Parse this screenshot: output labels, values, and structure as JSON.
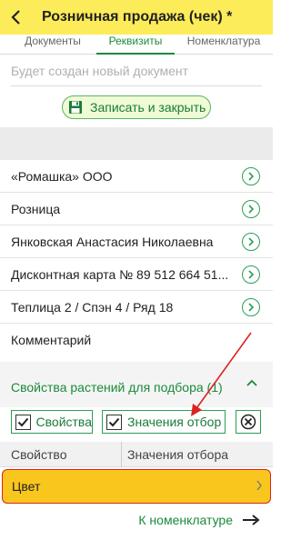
{
  "header": {
    "title": "Розничная продажа (чек) *",
    "back_icon": "chevron-left-icon"
  },
  "tabs": [
    {
      "label": "Документы",
      "active": false
    },
    {
      "label": "Реквизиты",
      "active": true
    },
    {
      "label": "Номенклатура",
      "active": false
    }
  ],
  "document": {
    "status_placeholder": "Будет создан новый документ",
    "save_button_label": "Записать и закрыть",
    "save_icon": "floppy-disk-icon"
  },
  "fields": [
    {
      "label": "«Ромашка» ООО"
    },
    {
      "label": "Розница"
    },
    {
      "label": "Янковская Анастасия Николаевна"
    },
    {
      "label": "Дисконтная карта № 89 512 664 51..."
    },
    {
      "label": "Теплица 2 / Спэн 4 / Ряд 18"
    }
  ],
  "comment": {
    "label": "Комментарий"
  },
  "properties": {
    "header": "Свойства растений для подбора (1)",
    "buttons": [
      {
        "label": "Свойства",
        "checked": true
      },
      {
        "label": "Значения отбор",
        "checked": true
      }
    ],
    "close_icon": "close-circle-icon",
    "table": {
      "columns": [
        "Свойство",
        "Значения отбора"
      ],
      "rows": [
        {
          "property": "Цвет",
          "value": ""
        }
      ]
    }
  },
  "footer": {
    "link_label": "К номенклатуре",
    "arrow_icon": "arrow-right-icon"
  },
  "colors": {
    "header_bg": "#fdec59",
    "accent_green": "#1a8a3a",
    "selected_row_bg": "#f8c61d",
    "annotation_red": "#dd2222"
  }
}
